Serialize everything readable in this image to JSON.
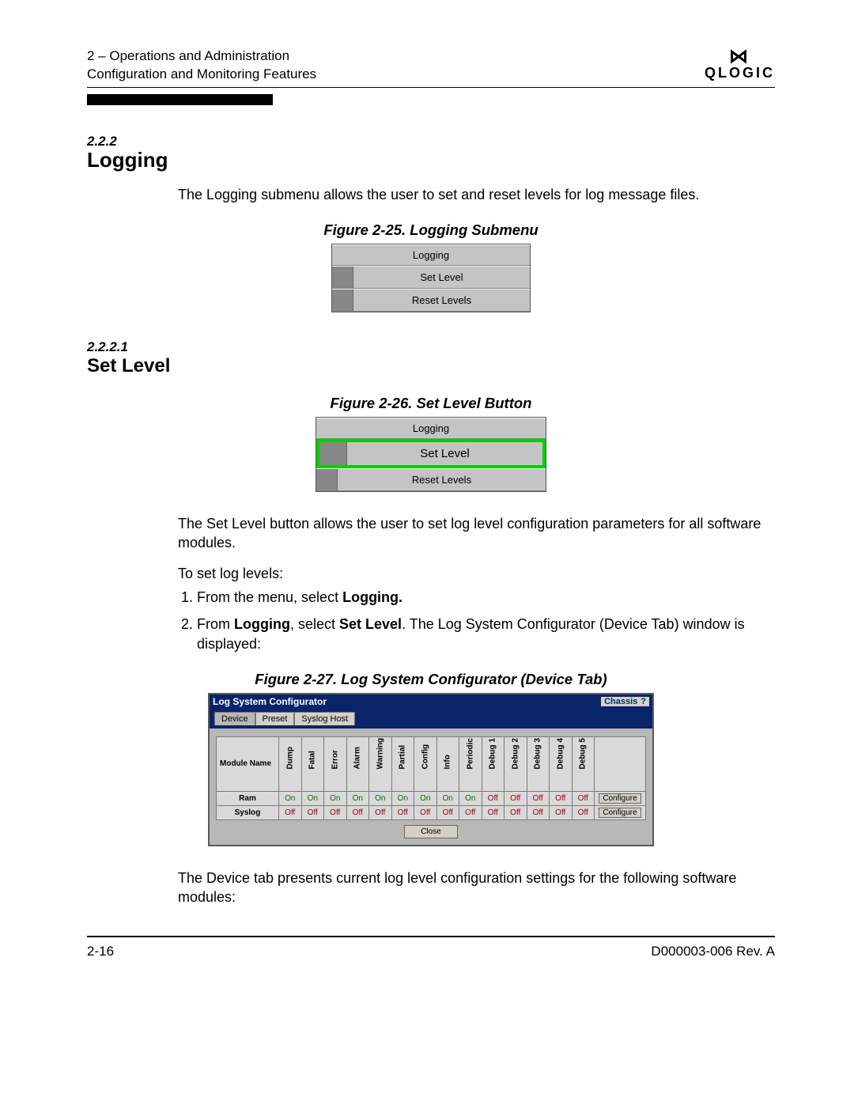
{
  "header": {
    "line1": "2 – Operations and Administration",
    "line2": "Configuration and Monitoring Features",
    "logo_text": "QLOGIC"
  },
  "section": {
    "num": "2.2.2",
    "title": "Logging",
    "intro": "The Logging submenu allows the user to set and reset levels for log message files."
  },
  "fig25": {
    "caption": "Figure 2-25. Logging Submenu",
    "head": "Logging",
    "item1": "Set Level",
    "item2": "Reset Levels"
  },
  "subsection": {
    "num": "2.2.2.1",
    "title": "Set Level"
  },
  "fig26": {
    "caption": "Figure 2-26. Set Level Button",
    "head": "Logging",
    "item1": "Set Level",
    "item2": "Reset Levels"
  },
  "para2": "The Set Level button allows the user to set log level configuration parameters for all software modules.",
  "para3": "To set log levels:",
  "steps": {
    "s1a": "From the menu, select ",
    "s1b": "Logging.",
    "s2a": "From ",
    "s2b": "Logging",
    "s2c": ", select ",
    "s2d": "Set Level",
    "s2e": ". The Log System Configurator (Device Tab) window is displayed:"
  },
  "fig27": {
    "caption": "Figure 2-27. Log System Configurator (Device Tab)",
    "title": "Log System Configurator",
    "chassis": "Chassis",
    "help": "?",
    "tabs": [
      "Device",
      "Preset",
      "Syslog Host"
    ],
    "col_module": "Module Name",
    "cols": [
      "Dump",
      "Fatal",
      "Error",
      "Alarm",
      "Warning",
      "Partial",
      "Config",
      "Info",
      "Periodic",
      "Debug 1",
      "Debug 2",
      "Debug 3",
      "Debug 4",
      "Debug 5"
    ],
    "rows": [
      {
        "name": "Ram",
        "v": [
          "On",
          "On",
          "On",
          "On",
          "On",
          "On",
          "On",
          "On",
          "On",
          "Off",
          "Off",
          "Off",
          "Off",
          "Off"
        ]
      },
      {
        "name": "Syslog",
        "v": [
          "Off",
          "Off",
          "Off",
          "Off",
          "Off",
          "Off",
          "Off",
          "Off",
          "Off",
          "Off",
          "Off",
          "Off",
          "Off",
          "Off"
        ]
      }
    ],
    "configure": "Configure",
    "close": "Close"
  },
  "para4": "The Device tab presents current log level configuration settings for the following software modules:",
  "footer": {
    "page": "2-16",
    "doc": "D000003-006 Rev. A"
  }
}
